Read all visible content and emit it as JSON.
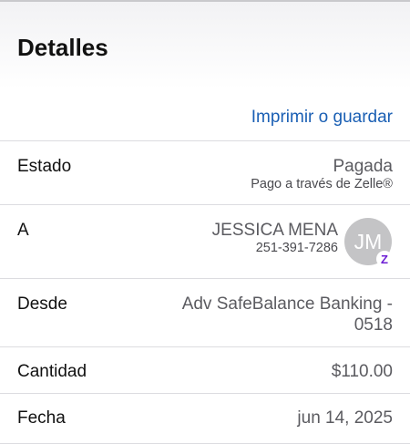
{
  "header": {
    "title": "Detalles"
  },
  "actions": {
    "print_label": "Imprimir o guardar"
  },
  "rows": {
    "estado": {
      "label": "Estado",
      "value": "Pagada",
      "sub": "Pago a través de Zelle®"
    },
    "to": {
      "label": "A",
      "name": "JESSICA MENA",
      "phone": "251-391-7286",
      "initials": "JM",
      "badge": "Z"
    },
    "from": {
      "label": "Desde",
      "line1": "Adv SafeBalance Banking -",
      "line2": "0518"
    },
    "amount": {
      "label": "Cantidad",
      "value": "$110.00"
    },
    "date": {
      "label": "Fecha",
      "value": "jun 14, 2025"
    }
  },
  "colors": {
    "link": "#1a5fb4",
    "zelle": "#6d1ed4",
    "avatar": "#c4c4c6"
  }
}
